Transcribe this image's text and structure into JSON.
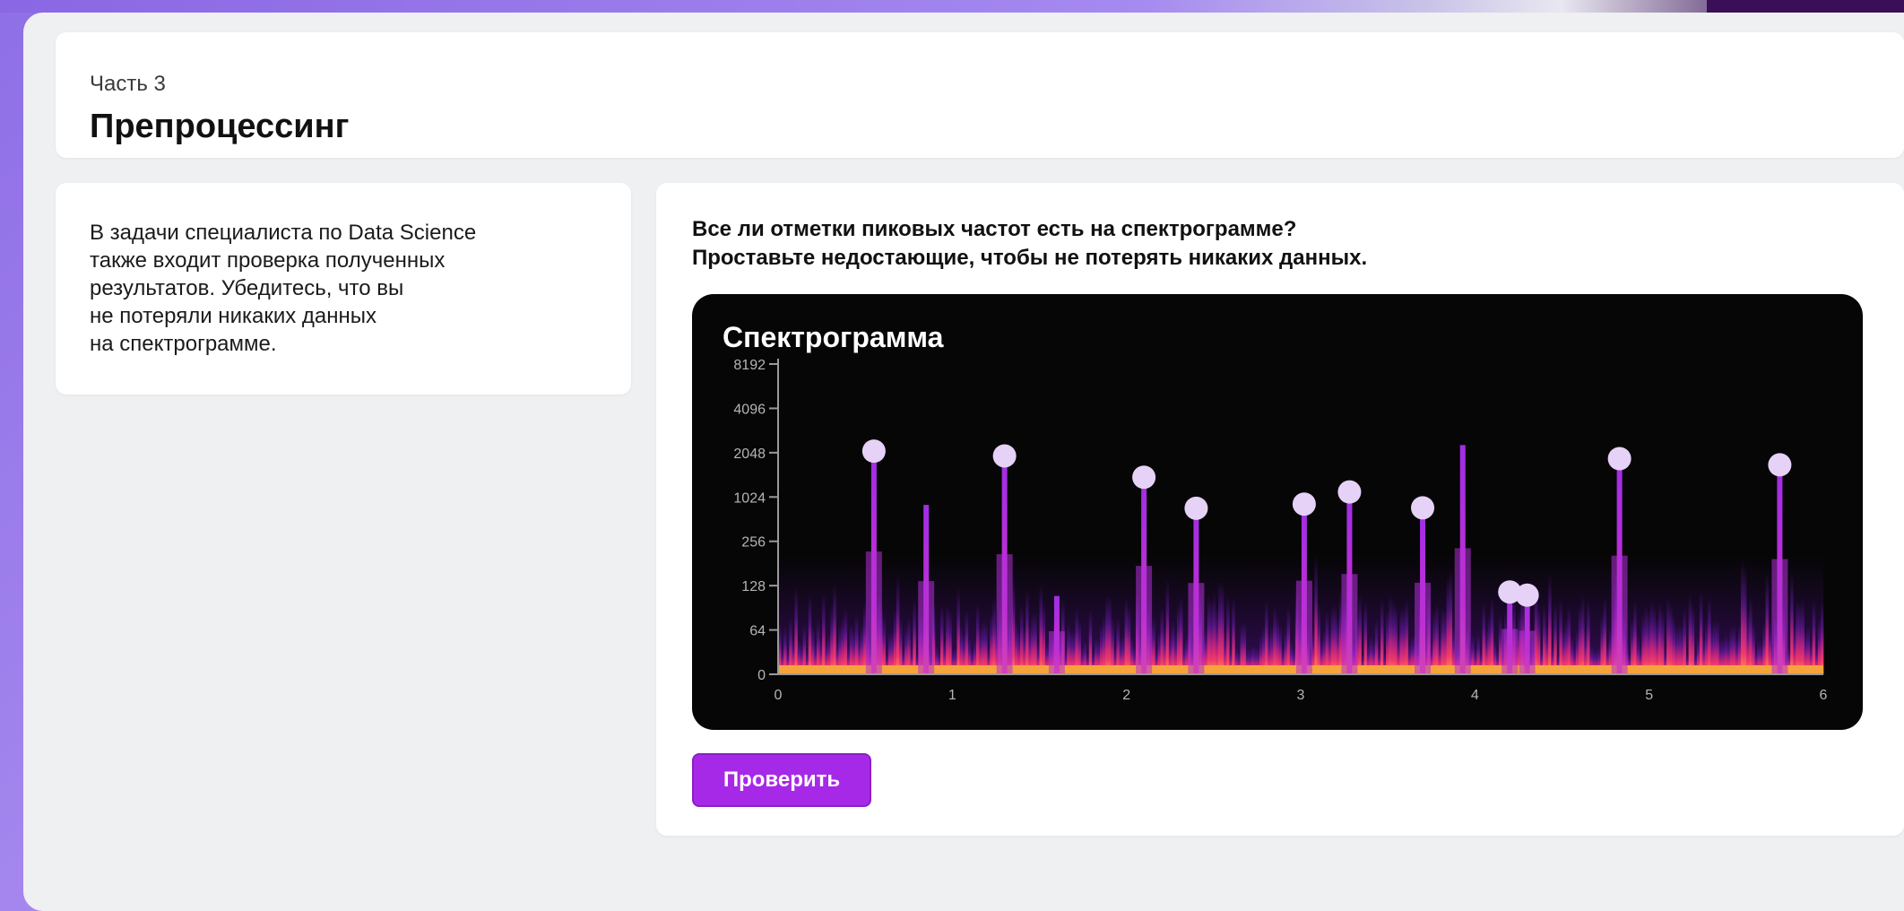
{
  "header": {
    "part": "Часть 3",
    "title": "Препроцессинг"
  },
  "info": {
    "text": "В задачи специалиста по Data Science\nтакже входит проверка полученных\nрезультатов. Убедитесь, что вы\nне потеряли никаких данных\nна спектрограмме."
  },
  "task": {
    "question": "Все ли отметки пиковых частот есть на спектрограмме?\nПроставьте недостающие, чтобы не потерять никаких данных.",
    "check_button": "Проверить"
  },
  "colors": {
    "accent": "#a729e8",
    "spectrogram_bg": "#060606",
    "marker": "#e6d2f6",
    "peak": "#b034f0"
  },
  "chart_data": {
    "type": "area",
    "title": "Спектрограмма",
    "x_ticks": [
      "0",
      "1",
      "2",
      "3",
      "4",
      "5",
      "6"
    ],
    "y_ticks": [
      "0",
      "64",
      "128",
      "256",
      "1024",
      "2048",
      "4096",
      "8192"
    ],
    "xlim": [
      0,
      6
    ],
    "ylim": [
      "0",
      "8192"
    ],
    "grid": false,
    "markers": [
      {
        "x": 0.55,
        "y": 4300
      },
      {
        "x": 1.3,
        "y": 3700
      },
      {
        "x": 2.1,
        "y": 1900
      },
      {
        "x": 2.4,
        "y": 720
      },
      {
        "x": 3.02,
        "y": 820
      },
      {
        "x": 3.28,
        "y": 1200
      },
      {
        "x": 3.7,
        "y": 730
      },
      {
        "x": 4.2,
        "y": 210
      },
      {
        "x": 4.3,
        "y": 190
      },
      {
        "x": 4.83,
        "y": 3400
      },
      {
        "x": 5.75,
        "y": 2800
      }
    ],
    "unmarked_peaks": [
      {
        "x": 0.85,
        "y": 800
      },
      {
        "x": 1.6,
        "y": 185
      },
      {
        "x": 3.93,
        "y": 5200
      }
    ]
  }
}
